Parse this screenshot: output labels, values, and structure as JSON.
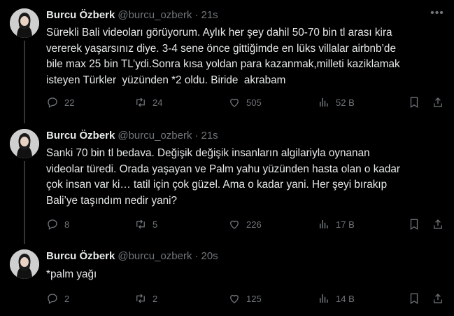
{
  "tweets": [
    {
      "name": "Burcu Özberk",
      "handle": "@burcu_ozberk",
      "time": "21s",
      "text": "Sürekli Bali videoları görüyorum. Aylık her şey dahil 50-70 bin tl arası kira\nvererek yaşarsınız diye. 3-4 sene önce gittiğimde en lüks villalar airbnb’de\nbile max 25 bin TL’ydi.Sonra kısa yoldan para kazanmak,milleti kaziklamak\nisteyen Türkler  yüzünden *2 oldu. Biride  akrabam",
      "replies": "22",
      "retweets": "24",
      "likes": "505",
      "views": "52 B"
    },
    {
      "name": "Burcu Özberk",
      "handle": "@burcu_ozberk",
      "time": "21s",
      "text": "Sanki 70 bin tl bedava. Değişik değişik insanların algilariyla oynanan\nvideolar türedi. Orada yaşayan ve Palm yahu yüzünden hasta olan o kadar\nçok insan var ki… tatil için çok güzel. Ama o kadar yani. Her şeyi bırakıp\nBali’ye taşındım nedir yani?",
      "replies": "8",
      "retweets": "5",
      "likes": "226",
      "views": "17 B"
    },
    {
      "name": "Burcu Özberk",
      "handle": "@burcu_ozberk",
      "time": "20s",
      "text": "*palm yağı",
      "replies": "2",
      "retweets": "2",
      "likes": "125",
      "views": "14 B"
    }
  ],
  "icons": {
    "reply": "reply-icon",
    "retweet": "retweet-icon",
    "like": "heart-icon",
    "views": "views-icon",
    "bookmark": "bookmark-icon",
    "share": "share-icon",
    "more": "more-icon"
  },
  "colors": {
    "background": "#000000",
    "text": "#e7e9ea",
    "muted": "#71767b",
    "thread_line": "#333639"
  }
}
